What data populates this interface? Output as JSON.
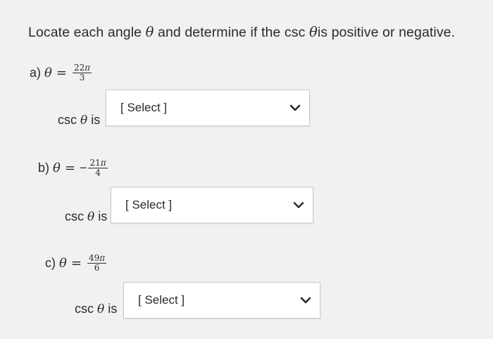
{
  "prompt": {
    "before": "Locate each angle",
    "theta": "θ",
    "middle": "and determine if the csc",
    "after": "is positive or negative."
  },
  "questions": [
    {
      "letter": "a)",
      "theta": "θ",
      "equals": "=",
      "sign": "",
      "numerator": "22",
      "pi": "π",
      "denominator": "3",
      "answer_prefix": "csc",
      "answer_theta": "θ",
      "answer_suffix": "is",
      "select_value": "[ Select ]"
    },
    {
      "letter": "b)",
      "theta": "θ",
      "equals": "=",
      "sign": "−",
      "numerator": "21",
      "pi": "π",
      "denominator": "4",
      "answer_prefix": "csc",
      "answer_theta": "θ",
      "answer_suffix": "is",
      "select_value": "[ Select ]"
    },
    {
      "letter": "c)",
      "theta": "θ",
      "equals": "=",
      "sign": "",
      "numerator": "49",
      "pi": "π",
      "denominator": "6",
      "answer_prefix": "csc",
      "answer_theta": "θ",
      "answer_suffix": "is",
      "select_value": "[ Select ]"
    }
  ],
  "icons": {
    "dropdown": "chevron-down-icon"
  }
}
